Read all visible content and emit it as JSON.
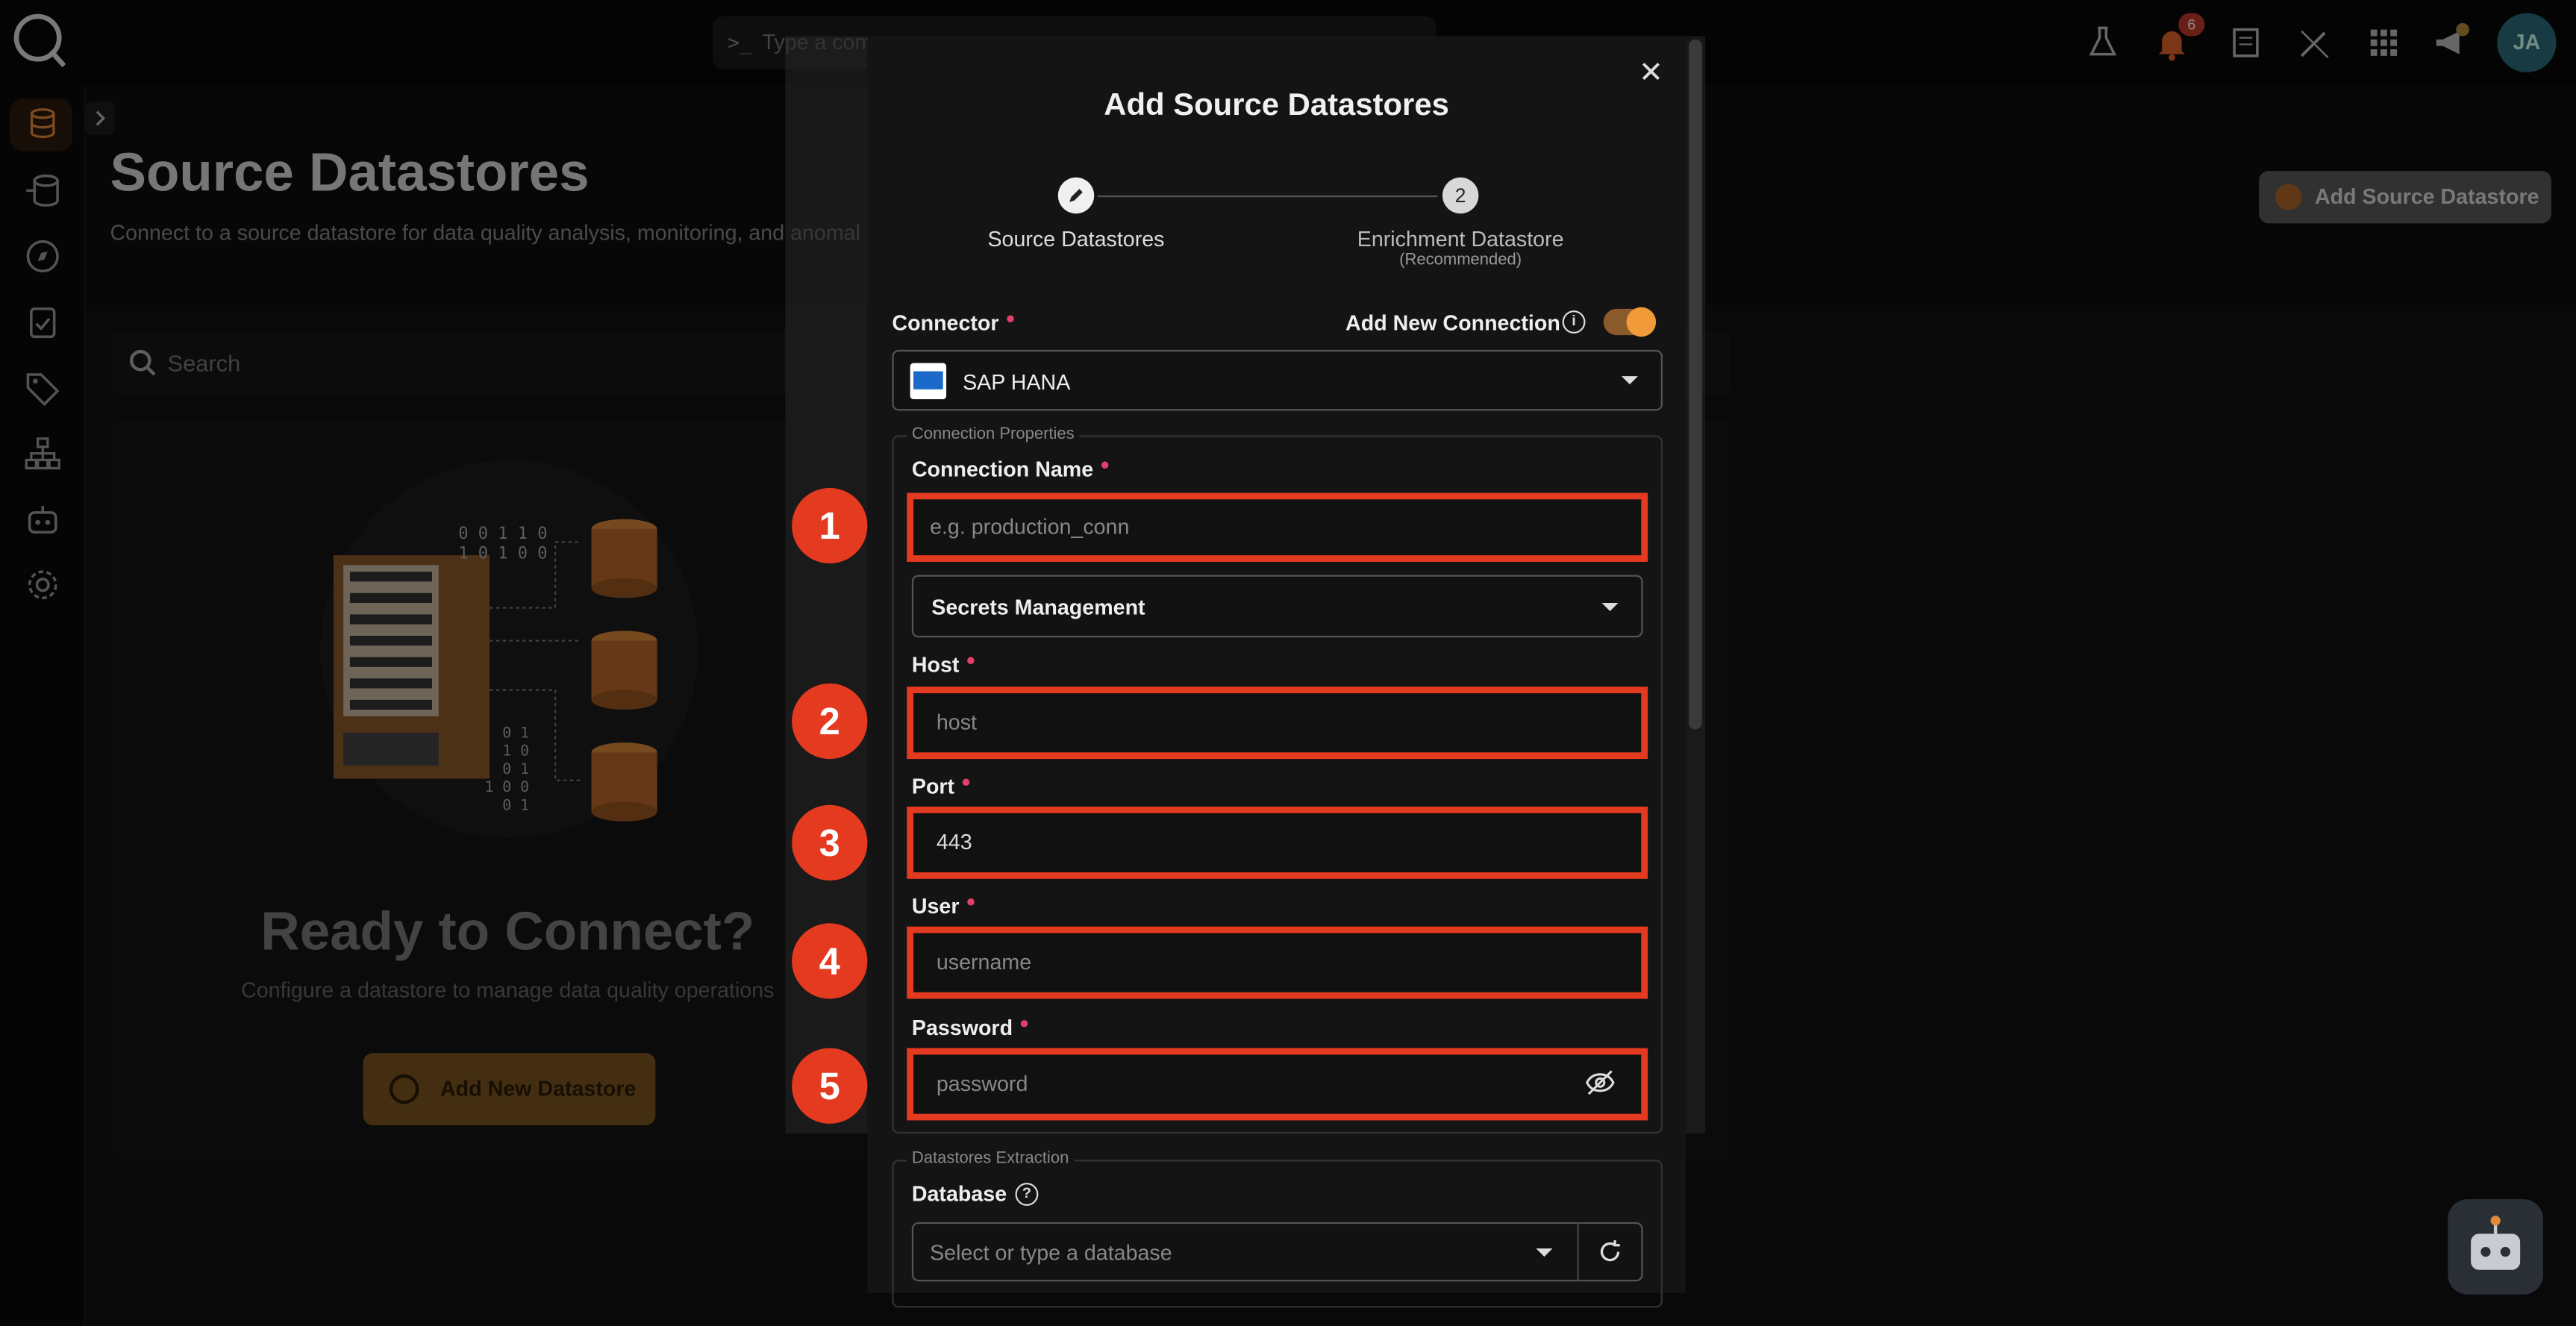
{
  "topbar": {
    "command_placeholder": "Type a comm",
    "notifications_count": "6",
    "avatar_initials": "JA"
  },
  "page": {
    "title": "Source Datastores",
    "subtitle": "Connect to a source datastore for data quality analysis, monitoring, and anomal",
    "add_button": "Add Source Datastore",
    "search_placeholder": "Search",
    "empty_title": "Ready to Connect?",
    "empty_subtitle": "Configure a datastore to manage data quality operations",
    "add_new_button": "Add New Datastore",
    "illustration_bits": [
      "0 0 1 1 0",
      "1 0 1 0 0",
      "0 1",
      "1 0",
      "0 1",
      "1 0 0",
      "0 1"
    ]
  },
  "modal": {
    "title": "Add Source Datastores",
    "step1_label": "Source Datastores",
    "step2_number": "2",
    "step2_label": "Enrichment Datastore",
    "step2_sublabel": "(Recommended)",
    "connector_label": "Connector",
    "add_new_connection_label": "Add New Connection",
    "connector_value": "SAP HANA",
    "connection_properties_legend": "Connection Properties",
    "connection_name_label": "Connection Name",
    "connection_name_placeholder": "e.g. production_conn",
    "secrets_management_label": "Secrets Management",
    "host_label": "Host",
    "host_placeholder": "host",
    "port_label": "Port",
    "port_value": "443",
    "user_label": "User",
    "user_placeholder": "username",
    "password_label": "Password",
    "password_placeholder": "password",
    "datastores_extraction_legend": "Datastores Extraction",
    "database_label": "Database",
    "database_placeholder": "Select or type a database"
  },
  "annotations": [
    "1",
    "2",
    "3",
    "4",
    "5"
  ],
  "colors": {
    "accent": "#f19a3a",
    "highlight": "#e43a20",
    "required": "#e23f6b"
  }
}
